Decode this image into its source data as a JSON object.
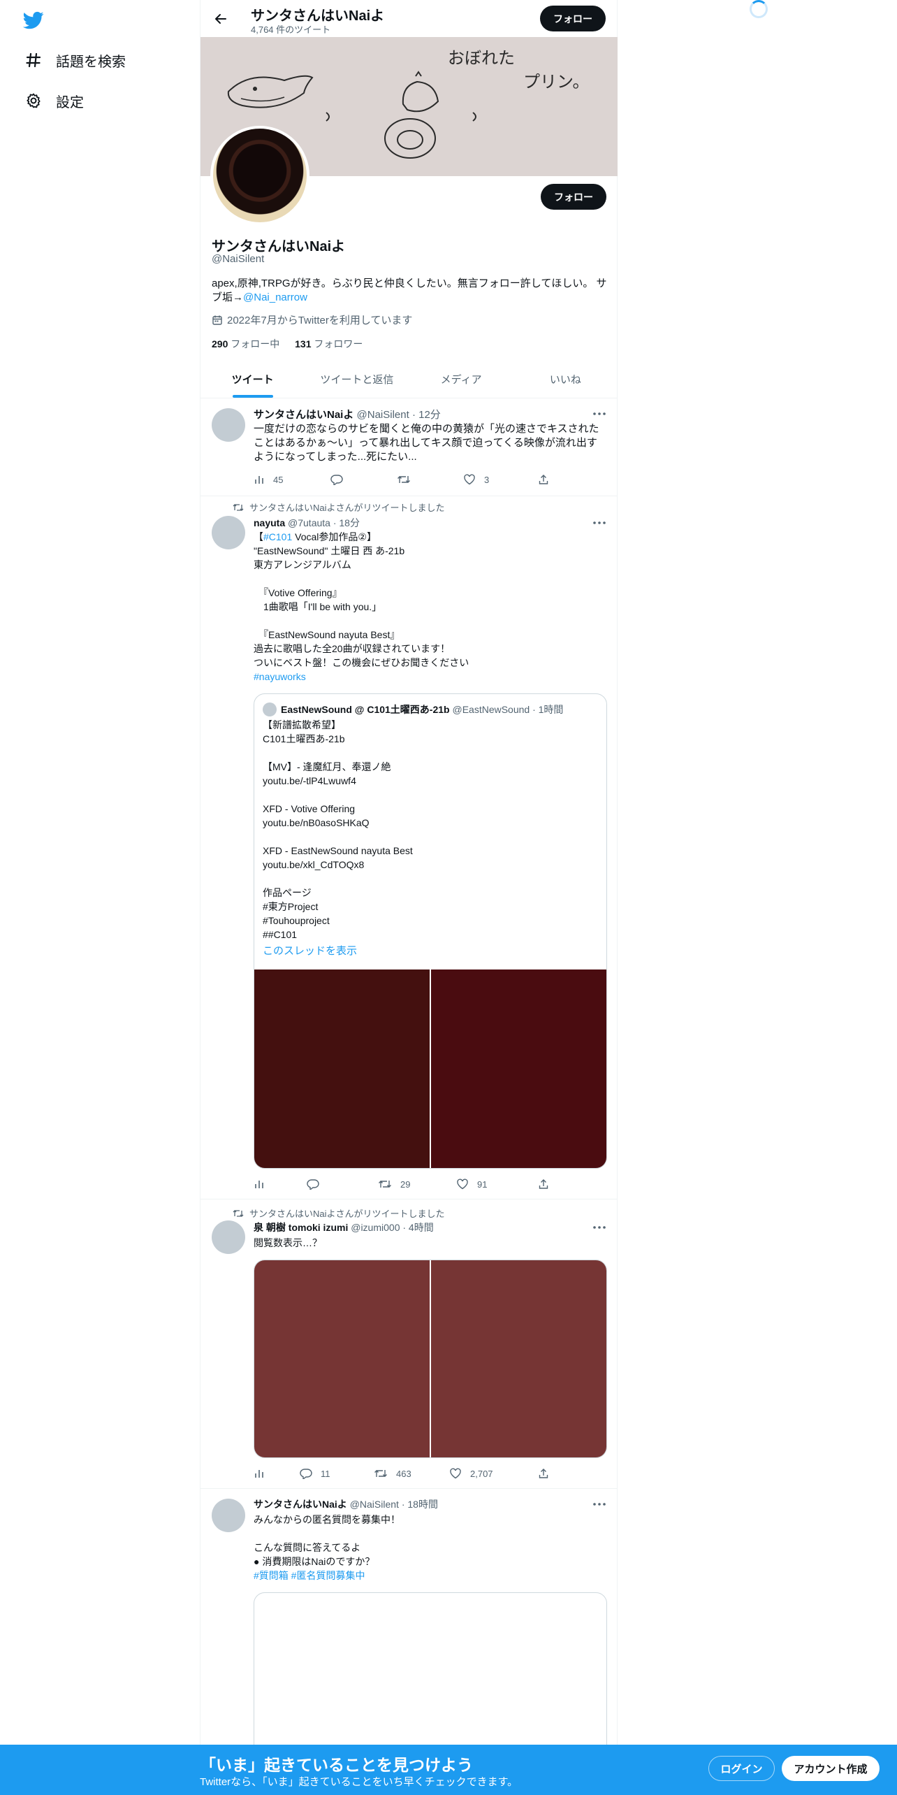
{
  "sidebar": {
    "logo_icon": "twitter-bird-icon",
    "items": [
      {
        "icon": "hashtag-icon",
        "label": "話題を検索"
      },
      {
        "icon": "gear-icon",
        "label": "設定"
      }
    ]
  },
  "header": {
    "name": "サンタさんはいNaiよ",
    "tweet_count": "4,764 件のツイート",
    "follow_label": "フォロー"
  },
  "profile": {
    "banner_text_line1": "おぼれた",
    "banner_text_line2": "プリン。",
    "name": "サンタさんはいNaiよ",
    "handle": "@NaiSilent",
    "bio_text": "apex,原神,TRPGが好き。らぶり民と仲良くしたい。無言フォロー許してほしい。 サブ垢→",
    "bio_link": "@Nai_narrow",
    "joined": "2022年7月からTwitterを利用しています",
    "following_count": "290",
    "following_label": "フォロー中",
    "followers_count": "131",
    "followers_label": "フォロワー",
    "follow_label": "フォロー"
  },
  "tabs": [
    "ツイート",
    "ツイートと返信",
    "メディア",
    "いいね"
  ],
  "tweets": [
    {
      "name": "サンタさんはいNaiよ",
      "meta": "@NaiSilent · 12分",
      "text": "一度だけの恋ならのサビを聞くと俺の中の黄猿が「光の速さでキスされたことはあるかぁ〜い」って暴れ出してキス顔で迫ってくる映像が流れ出すようになってしまった...死にたい...",
      "views": "45",
      "replies": "",
      "retweets": "",
      "likes": "3"
    },
    {
      "retweeted_by": "サンタさんはいNaiよさんがリツイートしました",
      "name": "nayuta",
      "meta": "@7utauta · 18分",
      "text_prefix": "【",
      "text_tag": "#C101",
      "text_main": " Vocal参加作品②】\n\"EastNewSound\" 土曜日 西 あ-21b\n東方アレンジアルバム\n\n　『Votive Offering』\n　1曲歌唱「I'll be with you.」\n\n　『EastNewSound nayuta Best』\n過去に歌唱した全20曲が収録されています！\nついにベスト盤！この機会にぜひお聞きください\n",
      "text_tag2": "#nayuworks",
      "quote": {
        "name": "EastNewSound @ C101土曜西あ-21b",
        "meta": "@EastNewSound · 1時間",
        "text": "【新譜拡散希望】\nC101土曜西あ-21b\n\n【MV】- 逢魔紅月、奉還ノ絶\nyoutu.be/-tlP4Lwuwf4\n\nXFD - Votive Offering\nyoutu.be/nB0asoSHKaQ\n\nXFD - EastNewSound nayuta Best\nyoutu.be/xkl_CdTOQx8\n\n作品ページ\n#東方Project\n#Touhouproject\n##C101",
        "show_thread": "このスレッドを表示"
      },
      "views": "",
      "replies": "",
      "retweets": "29",
      "likes": "91"
    },
    {
      "retweeted_by": "サンタさんはいNaiよさんがリツイートしました",
      "name": "泉 朝樹 tomoki izumi",
      "meta": "@izumi000 · 4時間",
      "text": "閲覧数表示…？",
      "views": "",
      "replies": "11",
      "retweets": "463",
      "likes": "2,707"
    },
    {
      "name": "サンタさんはいNaiよ",
      "meta": "@NaiSilent · 18時間",
      "text": "みんなからの匿名質問を募集中！\n\nこんな質問に答えてるよ\n● 消費期限はNaiのですか？\n",
      "tags": "#質問箱 #匿名質問募集中"
    }
  ],
  "bottom_bar": {
    "title": "「いま」起きていることを見つけよう",
    "subtitle": "Twitterなら、「いま」起きていることをいち早くチェックできます。",
    "login_label": "ログイン",
    "signup_label": "アカウント作成"
  },
  "colors": {
    "accent": "#1d9bf0",
    "text": "#0f1419",
    "muted": "#536471",
    "media_dark": "#44100f",
    "media_red": "#763534"
  }
}
